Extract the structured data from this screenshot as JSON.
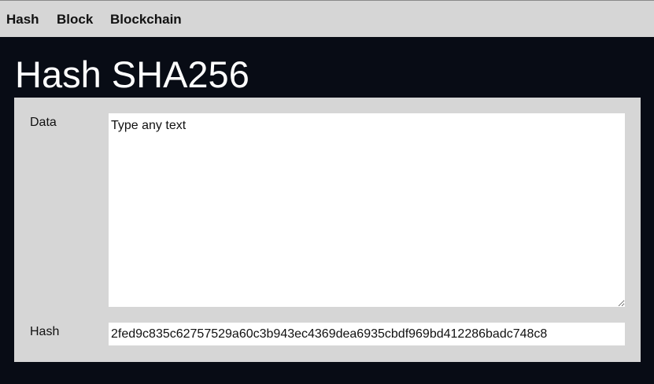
{
  "nav": {
    "items": [
      {
        "label": "Hash"
      },
      {
        "label": "Block"
      },
      {
        "label": "Blockchain"
      }
    ]
  },
  "page": {
    "title": "Hash SHA256"
  },
  "form": {
    "data_label": "Data",
    "data_value": "Type any text",
    "hash_label": "Hash",
    "hash_value": "2fed9c835c62757529a60c3b943ec4369dea6935cbdf969bd412286badc748c8"
  },
  "colors": {
    "background": "#080c15",
    "panel": "#d6d6d6",
    "field": "#ffffff",
    "text": "#111111",
    "title": "#ffffff"
  }
}
